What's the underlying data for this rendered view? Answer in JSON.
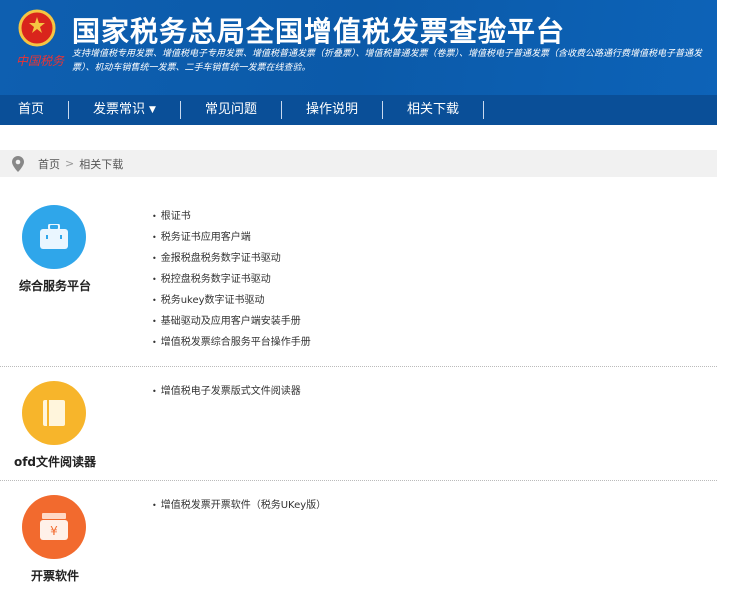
{
  "header": {
    "title": "国家税务总局全国增值税发票查验平台",
    "subtitle": "支持增值税专用发票、增值税电子专用发票、增值税普通发票（折叠票）、增值税普通发票（卷票）、增值税电子普通发票（含收费公路通行费增值税电子普通发票）、机动车销售统一发票、二手车销售统一发票在线查验。",
    "brand": "中国税务"
  },
  "nav": [
    {
      "label": "首页"
    },
    {
      "label": "发票常识"
    },
    {
      "label": "常见问题"
    },
    {
      "label": "操作说明"
    },
    {
      "label": "相关下载"
    }
  ],
  "breadcrumb": {
    "home": "首页",
    "sep": ">",
    "current": "相关下载"
  },
  "sections": [
    {
      "label": "综合服务平台",
      "color": "#2fa6ea",
      "links": [
        "根证书",
        "税务证书应用客户端",
        "金报税盘税务数字证书驱动",
        "税控盘税务数字证书驱动",
        "税务ukey数字证书驱动",
        "基础驱动及应用客户端安装手册",
        "增值税发票综合服务平台操作手册"
      ]
    },
    {
      "label": "ofd文件阅读器",
      "color": "#f7b52b",
      "links": [
        "增值税电子发票版式文件阅读器"
      ]
    },
    {
      "label": "开票软件",
      "color": "#f26a2e",
      "links": [
        "增值税发票开票软件（税务UKey版）"
      ]
    }
  ]
}
